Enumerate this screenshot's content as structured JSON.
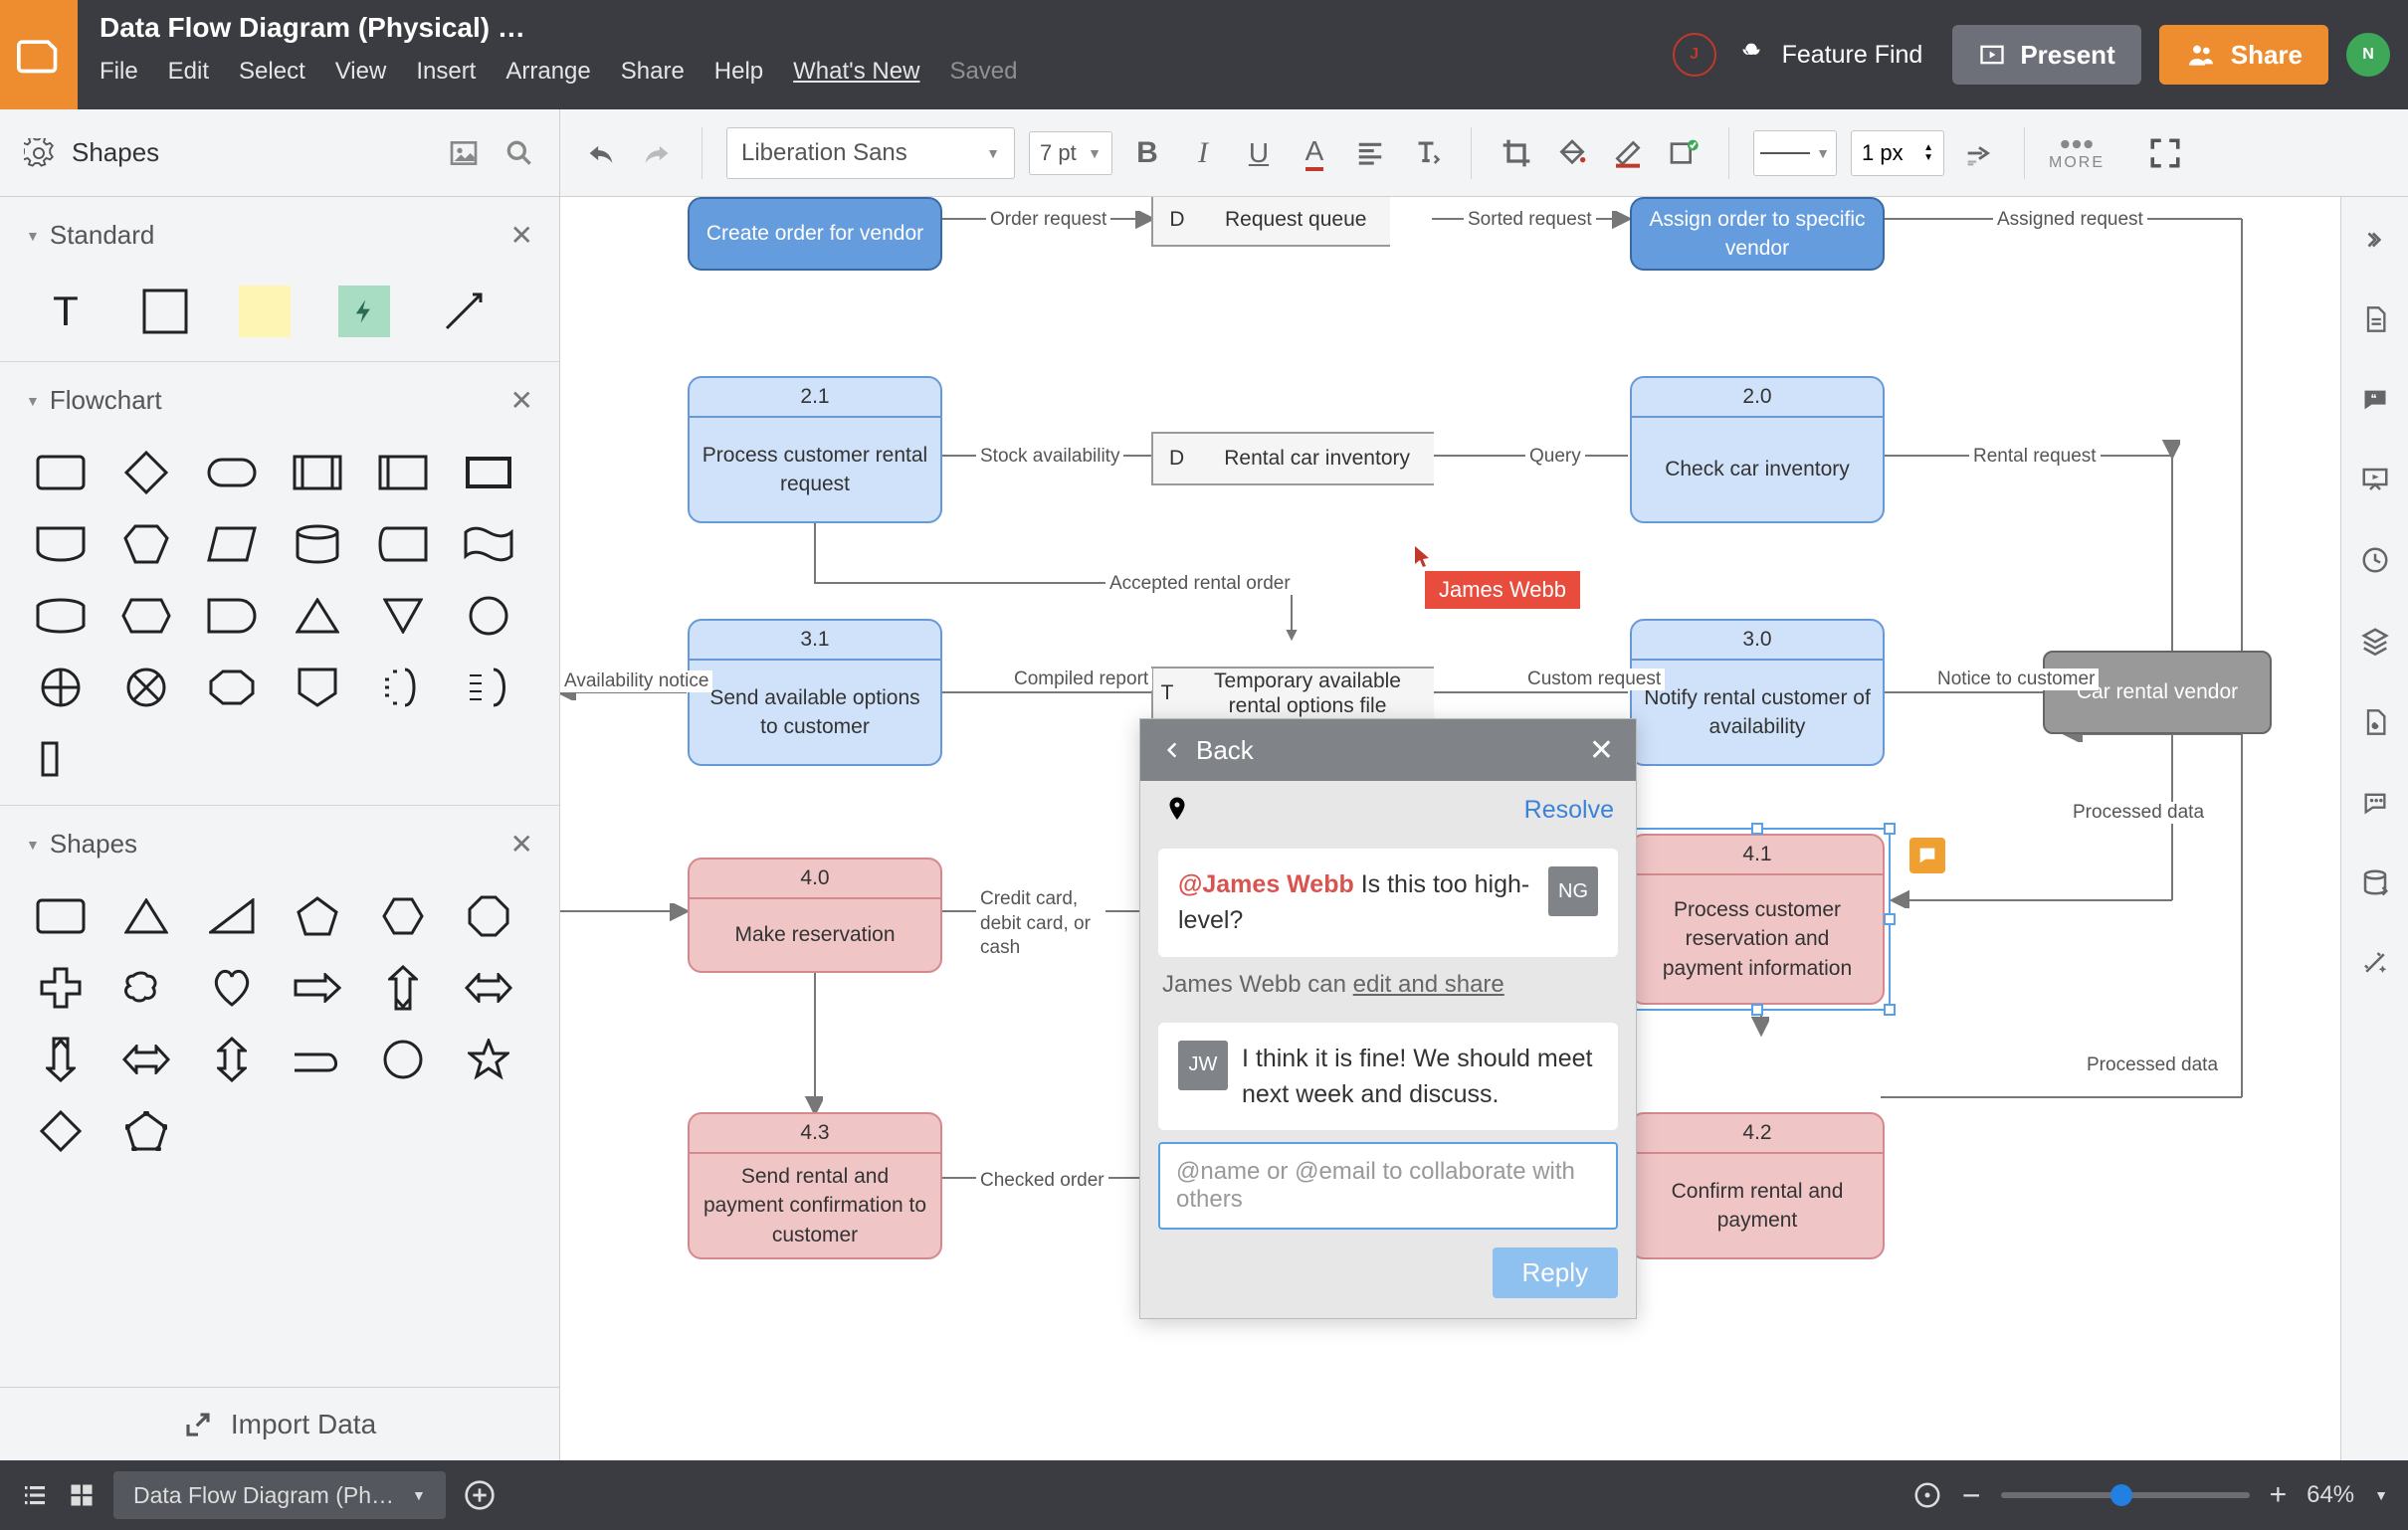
{
  "doc_title": "Data Flow Diagram (Physical) …",
  "menu": {
    "file": "File",
    "edit": "Edit",
    "select": "Select",
    "view": "View",
    "insert": "Insert",
    "arrange": "Arrange",
    "share": "Share",
    "help": "Help",
    "whatsnew": "What's New",
    "saved": "Saved"
  },
  "header": {
    "feature_find": "Feature Find",
    "present": "Present",
    "share": "Share",
    "avatar1": "J",
    "avatar2": "N"
  },
  "toolbar": {
    "shapes": "Shapes",
    "font": "Liberation Sans",
    "size": "7 pt",
    "line_width": "1 px",
    "more": "MORE"
  },
  "sections": {
    "standard": "Standard",
    "flowchart": "Flowchart",
    "shapes": "Shapes"
  },
  "import": "Import Data",
  "nodes": {
    "create_order": "Create order for vendor",
    "request_queue": "Request queue",
    "assign_order": "Assign order to specific vendor",
    "n21_id": "2.1",
    "n21": "Process customer rental request",
    "rental_inv": "Rental car inventory",
    "n20_id": "2.0",
    "n20": "Check car inventory",
    "n31_id": "3.1",
    "n31": "Send available options to customer",
    "temp_file": "Temporary available rental options file",
    "n30_id": "3.0",
    "n30": "Notify rental customer of availability",
    "vendor": "Car rental vendor",
    "n40_id": "4.0",
    "n40": "Make reservation",
    "n41_id": "4.1",
    "n41": "Process customer reservation and payment information",
    "n43_id": "4.3",
    "n43": "Send rental and payment confirmation to customer",
    "n42_id": "4.2",
    "n42": "Confirm rental and payment"
  },
  "datastores": {
    "d1": "D",
    "d2": "D",
    "t1": "T"
  },
  "edges": {
    "order_request": "Order request",
    "sorted_request": "Sorted request",
    "assigned_request": "Assigned request",
    "stock_avail": "Stock availability",
    "query": "Query",
    "rental_request": "Rental request",
    "accepted": "Accepted rental order",
    "compiled": "Compiled report",
    "custom_req": "Custom request",
    "notice": "Notice to customer",
    "avail_notice": "Availability notice",
    "credit": "Credit card, debit card, or cash",
    "processed_data1": "Processed data",
    "processed_data2": "Processed data",
    "checked_order": "Checked order"
  },
  "cursor": "James Webb",
  "comments": {
    "back": "Back",
    "resolve": "Resolve",
    "c1_av": "NG",
    "c1_mention": "@James Webb",
    "c1_text": " Is this too high-level?",
    "share_name": "James Webb",
    "share_mid": " can ",
    "share_link": "edit and share",
    "c2_av": "JW",
    "c2_text": "I think it is fine! We should meet next week and discuss.",
    "placeholder": "@name or @email to collaborate with others",
    "reply": "Reply"
  },
  "footer": {
    "tab": "Data Flow Diagram (Ph…",
    "zoom": "64%"
  }
}
